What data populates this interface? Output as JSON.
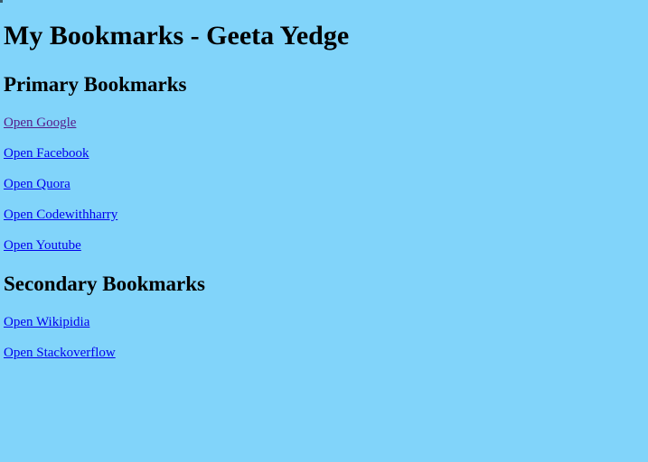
{
  "page": {
    "title": "My Bookmarks - Geeta Yedge",
    "background_color": "#81d4fa"
  },
  "primary": {
    "heading": "Primary Bookmarks",
    "links": [
      {
        "label": "Open Google",
        "visited": true
      },
      {
        "label": "Open Facebook",
        "visited": false
      },
      {
        "label": "Open Quora",
        "visited": false
      },
      {
        "label": "Open Codewithharry",
        "visited": false
      },
      {
        "label": "Open Youtube",
        "visited": false
      }
    ]
  },
  "secondary": {
    "heading": "Secondary Bookmarks",
    "links": [
      {
        "label": "Open Wikipidia",
        "visited": false
      },
      {
        "label": "Open Stackoverflow",
        "visited": false
      }
    ]
  },
  "colors": {
    "link": "#0000ee",
    "link_visited": "#551a8b",
    "text": "#000000"
  }
}
